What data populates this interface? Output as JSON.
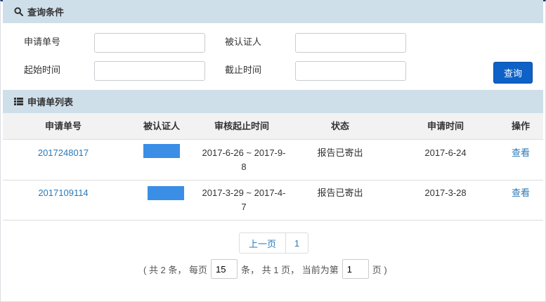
{
  "search_panel": {
    "title": "查询条件",
    "fields": {
      "app_no_label": "申请单号",
      "certified_label": "被认证人",
      "start_time_label": "起始时间",
      "end_time_label": "截止时间",
      "app_no_value": "",
      "certified_value": "",
      "start_time_value": "",
      "end_time_value": ""
    },
    "query_button": "查询"
  },
  "list_panel": {
    "title": "申请单列表",
    "columns": [
      "申请单号",
      "被认证人",
      "审核起止时间",
      "状态",
      "申请时间",
      "操作"
    ],
    "rows": [
      {
        "app_no": "2017248017",
        "period_line1": "2017-6-26 ~ 2017-9-",
        "period_line2": "8",
        "status": "报告已寄出",
        "apply_time": "2017-6-24",
        "action": "查看"
      },
      {
        "app_no": "2017109114",
        "period_line1": "2017-3-29 ~ 2017-4-",
        "period_line2": "7",
        "status": "报告已寄出",
        "apply_time": "2017-3-28",
        "action": "查看"
      }
    ]
  },
  "pagination": {
    "prev_label": "上一页",
    "current_page_button": "1",
    "info_prefix": "( 共 2 条， 每页",
    "page_size": "15",
    "info_middle": "条， 共 1 页， 当前为第",
    "current_page": "1",
    "info_suffix": "页 )"
  },
  "colors": {
    "header_bg": "#cfdfea",
    "top_border": "#1f3e73",
    "primary_button": "#0e62c7",
    "link": "#2a7ab8",
    "redaction": "#3a8ee6"
  }
}
